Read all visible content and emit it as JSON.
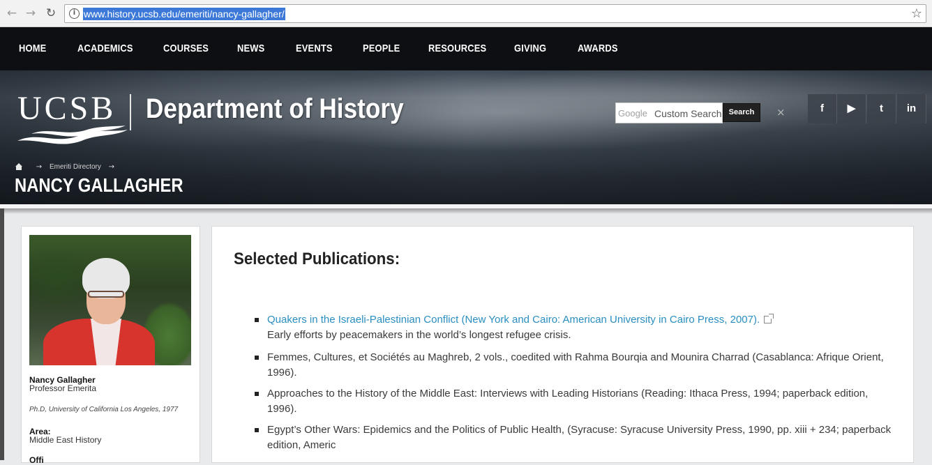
{
  "browser": {
    "url": "www.history.ucsb.edu/emeriti/nancy-gallagher/"
  },
  "nav": {
    "items": [
      "HOME",
      "ACADEMICS",
      "COURSES",
      "NEWS",
      "EVENTS",
      "PEOPLE",
      "RESOURCES",
      "GIVING",
      "AWARDS"
    ]
  },
  "header": {
    "logo_text": "UCSB",
    "department": "Department of History",
    "search_brand": "Google",
    "search_placeholder": "Custom Search",
    "search_button": "Search",
    "clear_symbol": "×",
    "social": [
      "f",
      "▶",
      "t",
      "in"
    ]
  },
  "breadcrumb": {
    "section": "Emeriti Directory",
    "arrow": "→"
  },
  "page_title": "NANCY GALLAGHER",
  "profile": {
    "name": "Nancy Gallagher",
    "role": "Professor Emerita",
    "degree": "Ph.D, University of California Los Angeles, 1977",
    "area_label": "Area:",
    "area": "Middle East History",
    "office_label": "Offi"
  },
  "publications": {
    "heading": "Selected Publications:",
    "items": [
      {
        "title": "Quakers in the Israeli-Palestinian Conflict (New York and Cairo: American University in Cairo Press, 2007).",
        "note": "Early efforts by peacemakers in the world’s longest refugee crisis."
      },
      {
        "line1": "Femmes, Cultures, et Sociétés au Maghreb, 2 vols., coedited with Rahma Bourqia and Mounira Charrad (Casablanca: Afrique Orient,",
        "line2": "1996)."
      },
      {
        "line1": "Approaches to the History of the Middle East: Interviews with Leading Historians (Reading: Ithaca Press, 1994; paperback edition,",
        "line2": "1996)."
      },
      {
        "line1": "Egypt’s Other Wars: Epidemics and the Politics of Public Health, (Syracuse: Syracuse University Press, 1990, pp. xiii + 234; paperback",
        "line2": "edition, Americ"
      }
    ]
  }
}
